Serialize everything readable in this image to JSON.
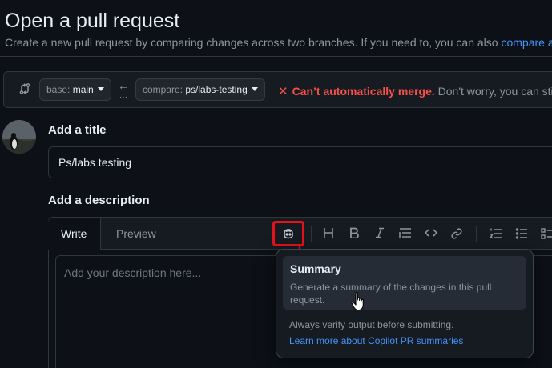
{
  "header": {
    "title": "Open a pull request",
    "subtitle": "Create a new pull request by comparing changes across two branches. If you need to, you can also",
    "subtitle_link": "compare acr"
  },
  "compare_bar": {
    "base_label": "base:",
    "base_value": "main",
    "compare_label": "compare:",
    "compare_value": "ps/labs-testing",
    "merge_status": "Can’t automatically merge.",
    "merge_info": "Don't worry, you can stil"
  },
  "form": {
    "title_heading": "Add a title",
    "title_value": "Ps/labs testing",
    "description_heading": "Add a description"
  },
  "editor": {
    "tabs": [
      {
        "label": "Write",
        "active": true
      },
      {
        "label": "Preview",
        "active": false
      }
    ],
    "placeholder": "Add your description here...",
    "toolbar_icons": [
      "copilot-icon",
      "heading-icon",
      "bold-icon",
      "italic-icon",
      "quote-icon",
      "code-icon",
      "link-icon",
      "ordered-list-icon",
      "unordered-list-icon",
      "task-list-icon"
    ]
  },
  "copilot_popover": {
    "item_title": "Summary",
    "item_description": "Generate a summary of the changes in this pull request.",
    "note": "Always verify output before submitting.",
    "link": "Learn more about Copilot PR summaries"
  },
  "colors": {
    "background": "#0d1117",
    "accent_link": "#4493f8",
    "danger": "#f85149",
    "highlight": "#e5121a"
  }
}
